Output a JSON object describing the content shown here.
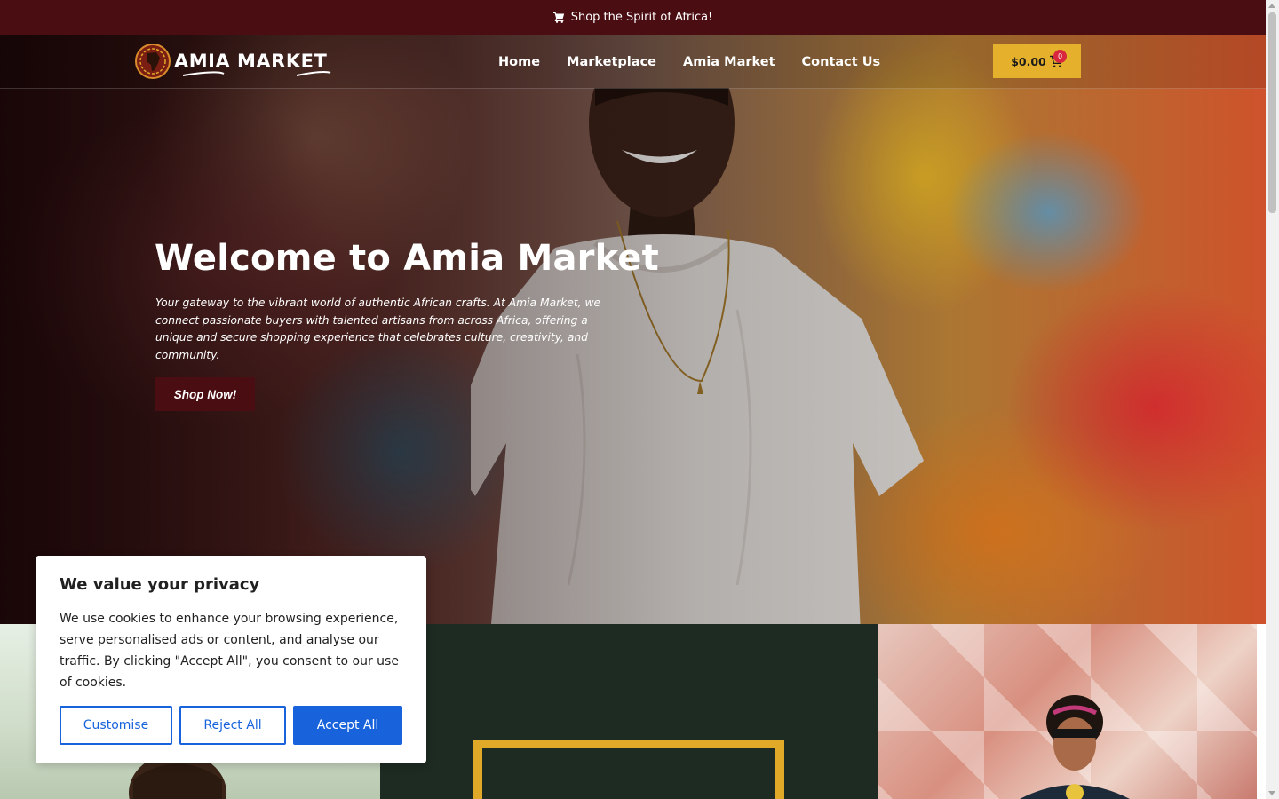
{
  "announcement": {
    "text": "Shop the Spirit of Africa!",
    "icon": "cart-icon"
  },
  "header": {
    "logo_text": "AMIA MARKET",
    "nav": [
      {
        "label": "Home"
      },
      {
        "label": "Marketplace"
      },
      {
        "label": "Amia Market"
      },
      {
        "label": "Contact Us"
      }
    ],
    "cart": {
      "total": "$0.00",
      "count": "0",
      "icon": "shopping-cart-icon"
    }
  },
  "hero": {
    "title": "Welcome to Amia Market",
    "text": "Your gateway to the vibrant world of authentic African crafts. At Amia Market, we connect passionate buyers with talented artisans from across Africa, offering a unique and secure shopping experience that celebrates culture, creativity, and community.",
    "cta": "Shop Now!"
  },
  "cookie_banner": {
    "title": "We value your privacy",
    "body": "We use cookies to enhance your browsing experience, serve personalised ads or content, and analyse our traffic. By clicking \"Accept All\", you consent to our use of cookies.",
    "customise": "Customise",
    "reject": "Reject All",
    "accept": "Accept All"
  },
  "colors": {
    "brand_maroon": "#4a0d12",
    "accent_gold": "#e5b12c",
    "panel_green": "#1d2b22",
    "cookie_blue": "#1863dc"
  }
}
